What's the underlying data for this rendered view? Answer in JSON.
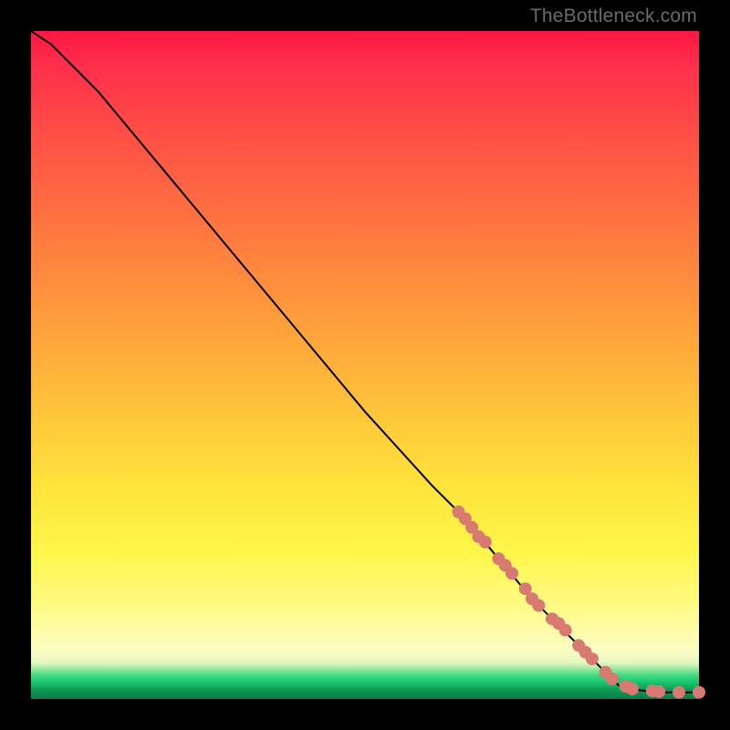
{
  "watermark": "TheBottleneck.com",
  "colors": {
    "dot": "#d87a72",
    "line": "#000000",
    "frame": "#000000"
  },
  "chart_data": {
    "type": "line",
    "title": "",
    "xlabel": "",
    "ylabel": "",
    "xlim": [
      0,
      100
    ],
    "ylim": [
      0,
      100
    ],
    "grid": false,
    "legend": false,
    "series": [
      {
        "name": "curve",
        "x": [
          0,
          3,
          6,
          10,
          15,
          20,
          30,
          40,
          50,
          60,
          65,
          70,
          75,
          80,
          83,
          86,
          88,
          90,
          92,
          94,
          96,
          98,
          100
        ],
        "y": [
          100,
          98,
          95,
          91,
          85,
          79,
          67,
          55,
          43,
          32,
          27,
          21,
          15,
          10,
          7,
          4,
          2,
          1.5,
          1.2,
          1.0,
          1.0,
          1.0,
          1.0
        ]
      }
    ],
    "points": [
      {
        "x": 64,
        "y": 28.0
      },
      {
        "x": 65,
        "y": 27.0
      },
      {
        "x": 66,
        "y": 25.7
      },
      {
        "x": 67,
        "y": 24.3
      },
      {
        "x": 68,
        "y": 23.5
      },
      {
        "x": 70,
        "y": 21.0
      },
      {
        "x": 71,
        "y": 20.0
      },
      {
        "x": 72,
        "y": 18.8
      },
      {
        "x": 74,
        "y": 16.5
      },
      {
        "x": 75,
        "y": 15.0
      },
      {
        "x": 76,
        "y": 14.0
      },
      {
        "x": 78,
        "y": 12.0
      },
      {
        "x": 79,
        "y": 11.3
      },
      {
        "x": 80,
        "y": 10.3
      },
      {
        "x": 82,
        "y": 8.0
      },
      {
        "x": 83,
        "y": 7.0
      },
      {
        "x": 84,
        "y": 6.0
      },
      {
        "x": 86,
        "y": 4.0
      },
      {
        "x": 87,
        "y": 3.0
      },
      {
        "x": 89,
        "y": 1.9
      },
      {
        "x": 90,
        "y": 1.5
      },
      {
        "x": 93,
        "y": 1.2
      },
      {
        "x": 94,
        "y": 1.1
      },
      {
        "x": 97,
        "y": 1.0
      },
      {
        "x": 100,
        "y": 1.0
      }
    ]
  }
}
